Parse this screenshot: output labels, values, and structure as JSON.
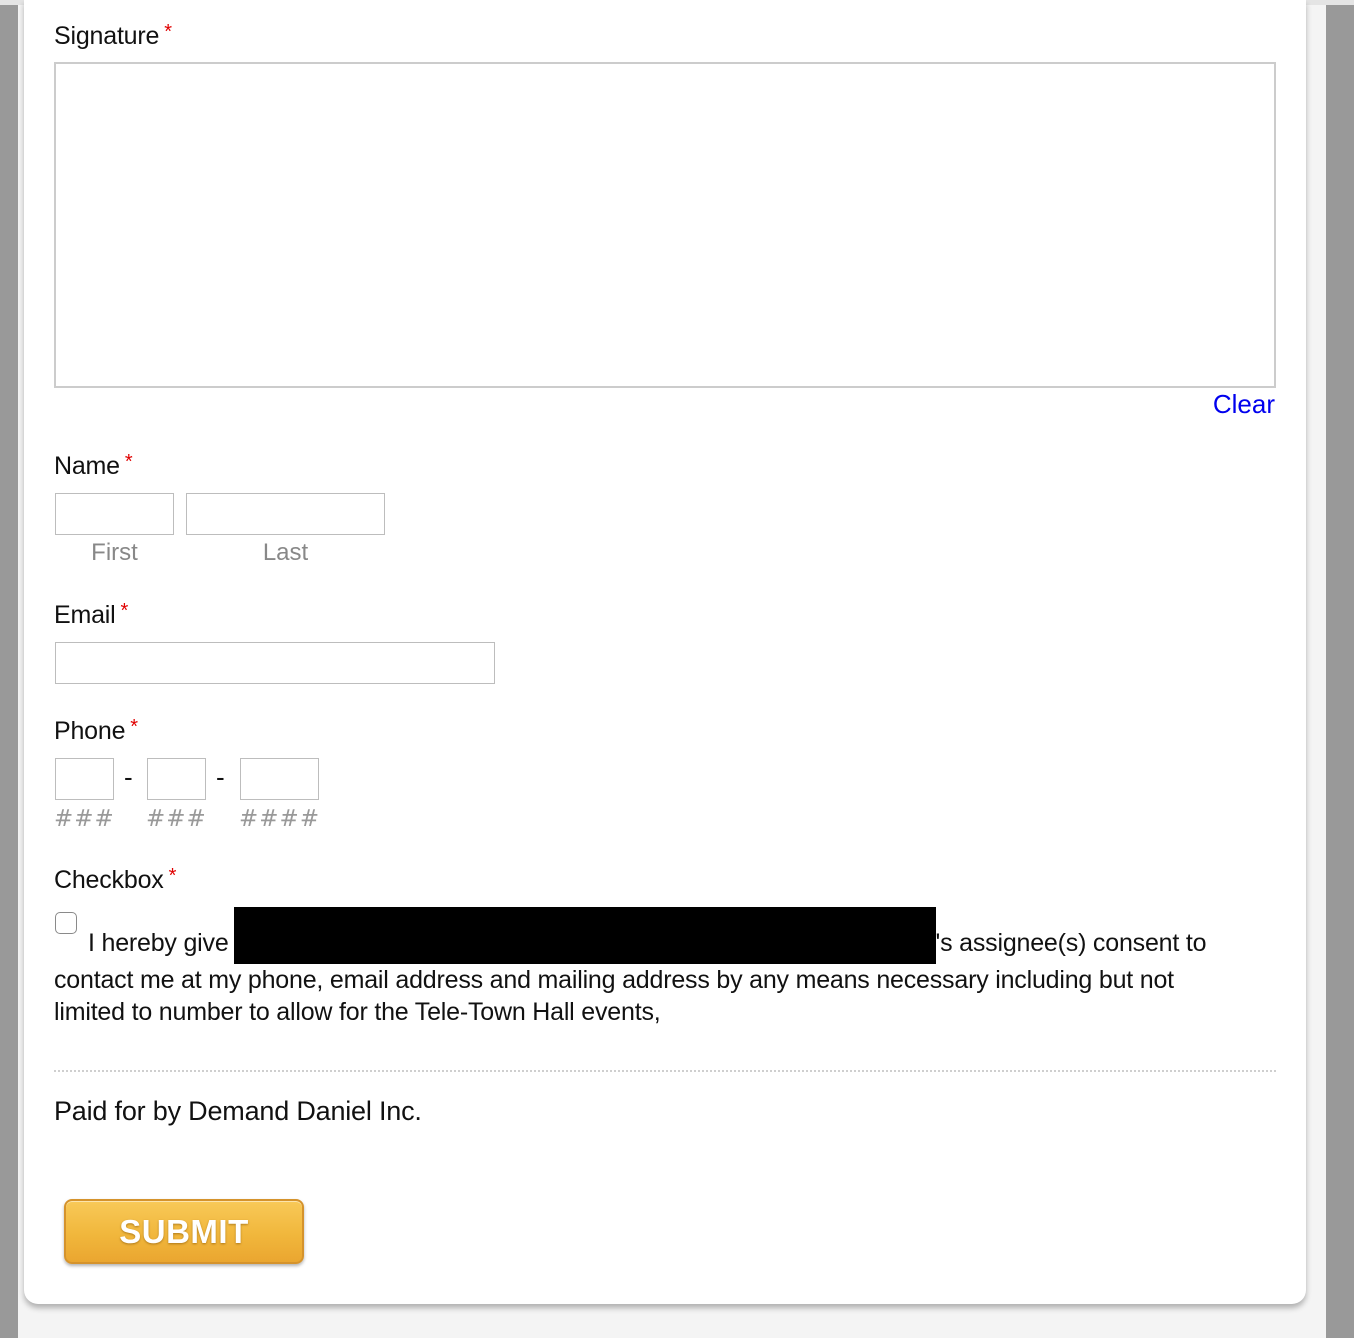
{
  "form": {
    "signature": {
      "label": "Signature",
      "required_mark": "*",
      "clear_label": "Clear"
    },
    "name": {
      "label": "Name",
      "required_mark": "*",
      "first_value": "",
      "last_value": "",
      "first_sublabel": "First",
      "last_sublabel": "Last"
    },
    "email": {
      "label": "Email",
      "required_mark": "*",
      "value": ""
    },
    "phone": {
      "label": "Phone",
      "required_mark": "*",
      "separator": "-",
      "area_hint": "###",
      "prefix_hint": "###",
      "line_hint": "####"
    },
    "checkbox": {
      "label": "Checkbox",
      "required_mark": "*",
      "checked": false,
      "text_before": "I hereby give",
      "text_after": "'s assignee(s) consent to contact me at my phone, email address and mailing address by any means necessary including but not limited to number to allow for the Tele-Town Hall events,"
    },
    "disclaimer": "Paid for by Demand Daniel Inc.",
    "submit_label": "SUBMIT"
  },
  "colors": {
    "required": "#e00000",
    "link": "#0000ee",
    "submit_button": "#f1b73c"
  }
}
